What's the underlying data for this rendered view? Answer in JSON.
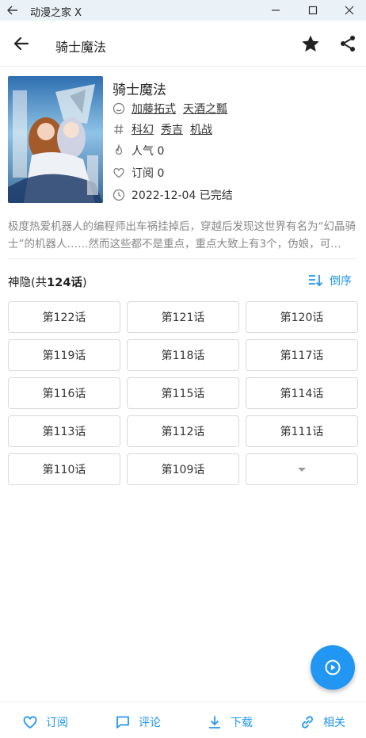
{
  "window": {
    "title": "动漫之家 X",
    "icons": [
      "back-arrow-icon",
      "minimize-icon",
      "maximize-icon",
      "close-icon"
    ]
  },
  "appbar": {
    "title": "骑士魔法",
    "icons": [
      "back-arrow-icon",
      "star-icon",
      "share-icon"
    ]
  },
  "comic": {
    "title": "骑士魔法",
    "authors": [
      "加藤拓式",
      "天酒之瓢"
    ],
    "tags": [
      "科幻",
      "秀吉",
      "机战"
    ],
    "popularity": "人气 0",
    "subscriptions": "订阅 0",
    "status": "2022-12-04 已完结",
    "description": "极度热爱机器人的编程师出车祸挂掉后，穿越后发现这世界有名为“幻晶骑士”的机器人……然而这些都不是重点，重点大致上有3个，伪娘，可…"
  },
  "chapters": {
    "group_prefix": "神隐(共",
    "count_label": "124话",
    "group_suffix": ")",
    "sort_label": "倒序",
    "items": [
      "第122话",
      "第121话",
      "第120话",
      "第119话",
      "第118话",
      "第117话",
      "第116话",
      "第115话",
      "第114话",
      "第113话",
      "第112话",
      "第111话",
      "第110话",
      "第109话"
    ]
  },
  "bottom_nav": {
    "subscribe": "订阅",
    "comment": "评论",
    "download": "下载",
    "related": "相关"
  },
  "colors": {
    "accent": "#2196f3",
    "titlebar": "#eaf2f7",
    "text": "#222222",
    "muted": "#888888",
    "border": "#d9d9d9"
  }
}
